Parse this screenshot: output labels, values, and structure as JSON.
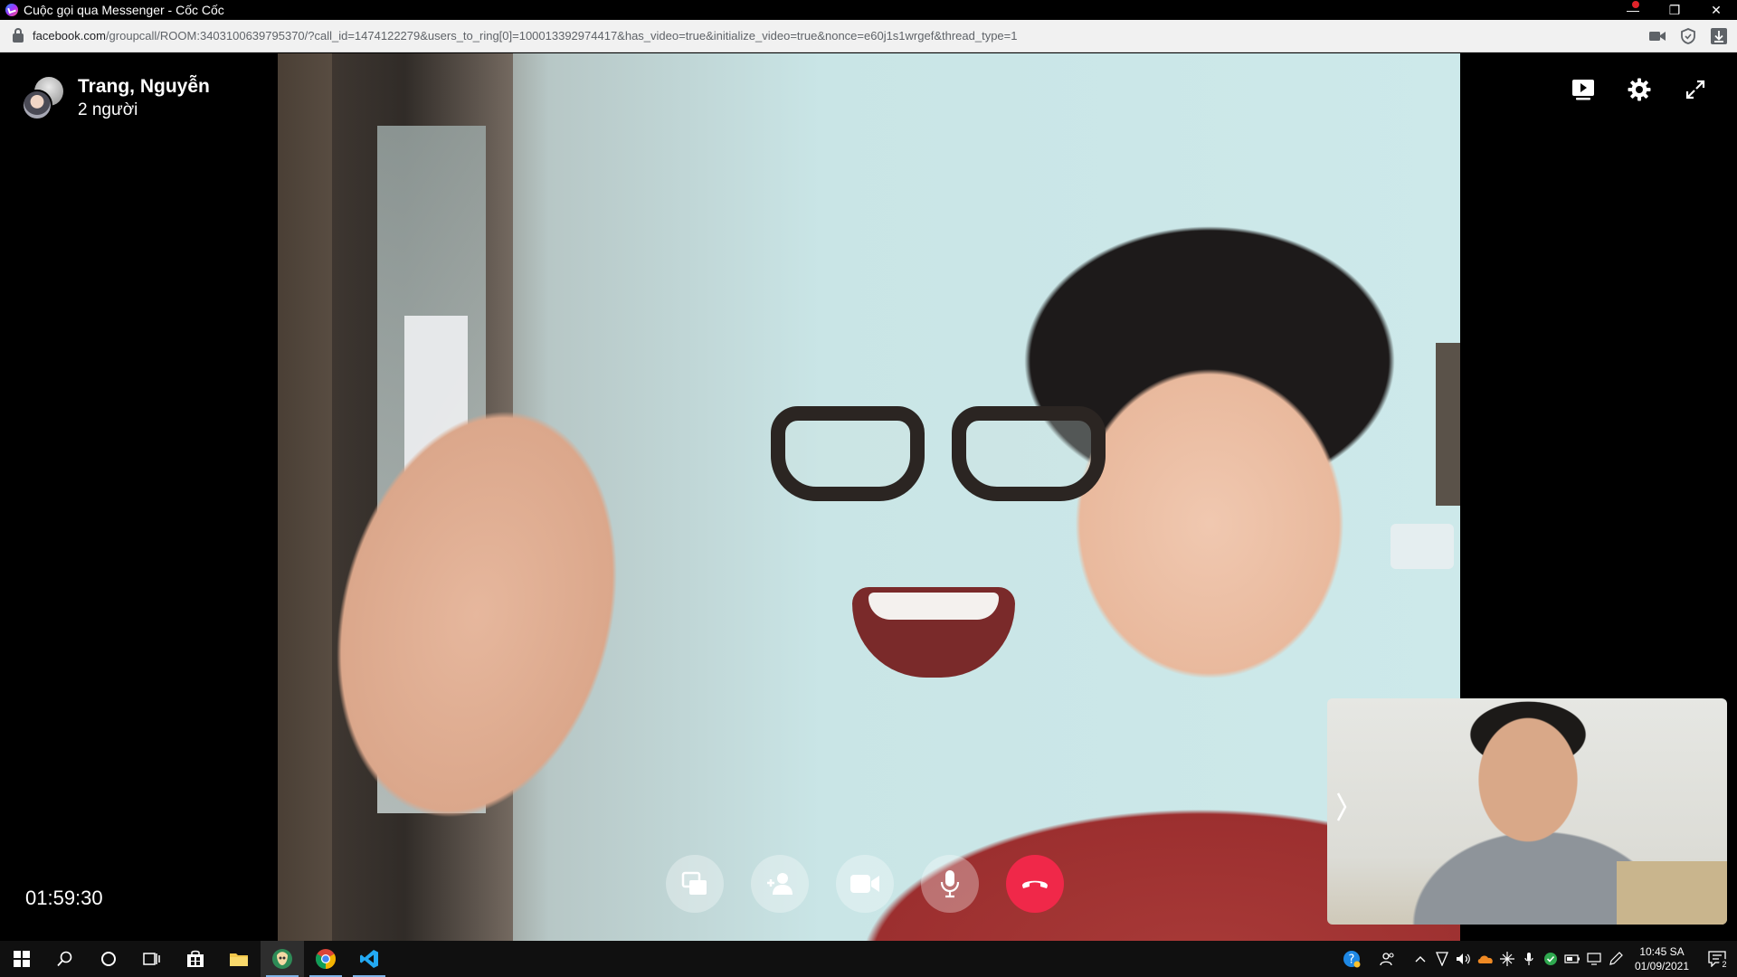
{
  "window": {
    "title": "Cuộc gọi qua Messenger - Cốc Cốc",
    "controls": {
      "minimize": "—",
      "restore": "❐",
      "close": "✕"
    }
  },
  "addressbar": {
    "host": "facebook.com",
    "path": "/groupcall/ROOM:3403100639795370/?call_id=1474122279&users_to_ring[0]=100013392974417&has_video=true&initialize_video=true&nonce=e60j1s1wrgef&thread_type=1"
  },
  "call": {
    "name": "Trang, Nguyễn",
    "participants": "2 người",
    "timer": "01:59:30"
  },
  "taskbar": {
    "clock_time": "10:45 SA",
    "clock_date": "01/09/2021",
    "notification_count": "2"
  },
  "colors": {
    "end_call": "#f02849",
    "control_bg": "rgba(255,255,255,0.32)",
    "taskbar_bg": "#101010"
  }
}
